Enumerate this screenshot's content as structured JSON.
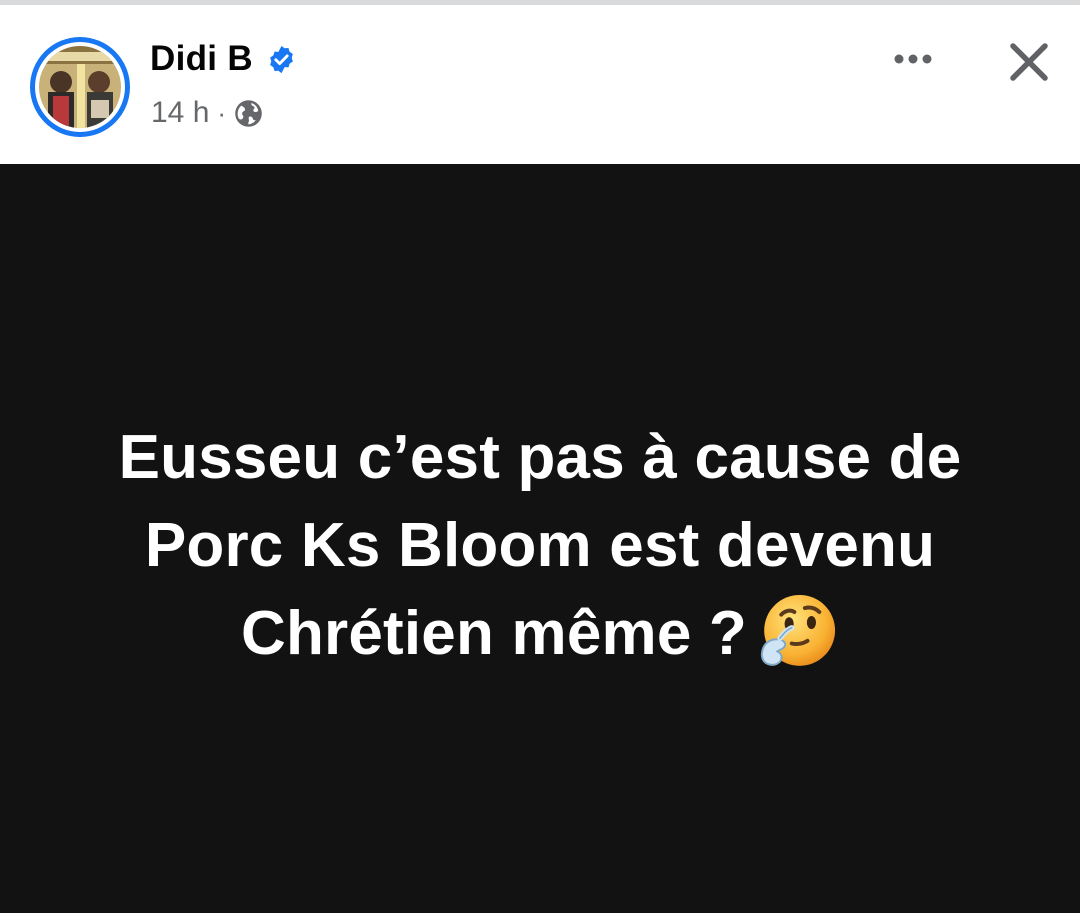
{
  "post": {
    "author": "Didi B",
    "time": "14 h",
    "separator": "·",
    "text_lines": [
      "Eusseu c’est pas à cause de",
      "Porc Ks Bloom est devenu",
      "Chrétien même ?"
    ]
  },
  "icons": {
    "verified": "verified-badge-icon",
    "audience": "globe-icon",
    "more": "more-options-icon",
    "close": "close-icon",
    "emoji": "thinking-face-emoji"
  },
  "colors": {
    "accent": "#1877f2",
    "post_background": "#121212",
    "post_text": "#ffffff",
    "meta_text": "#65676b"
  }
}
